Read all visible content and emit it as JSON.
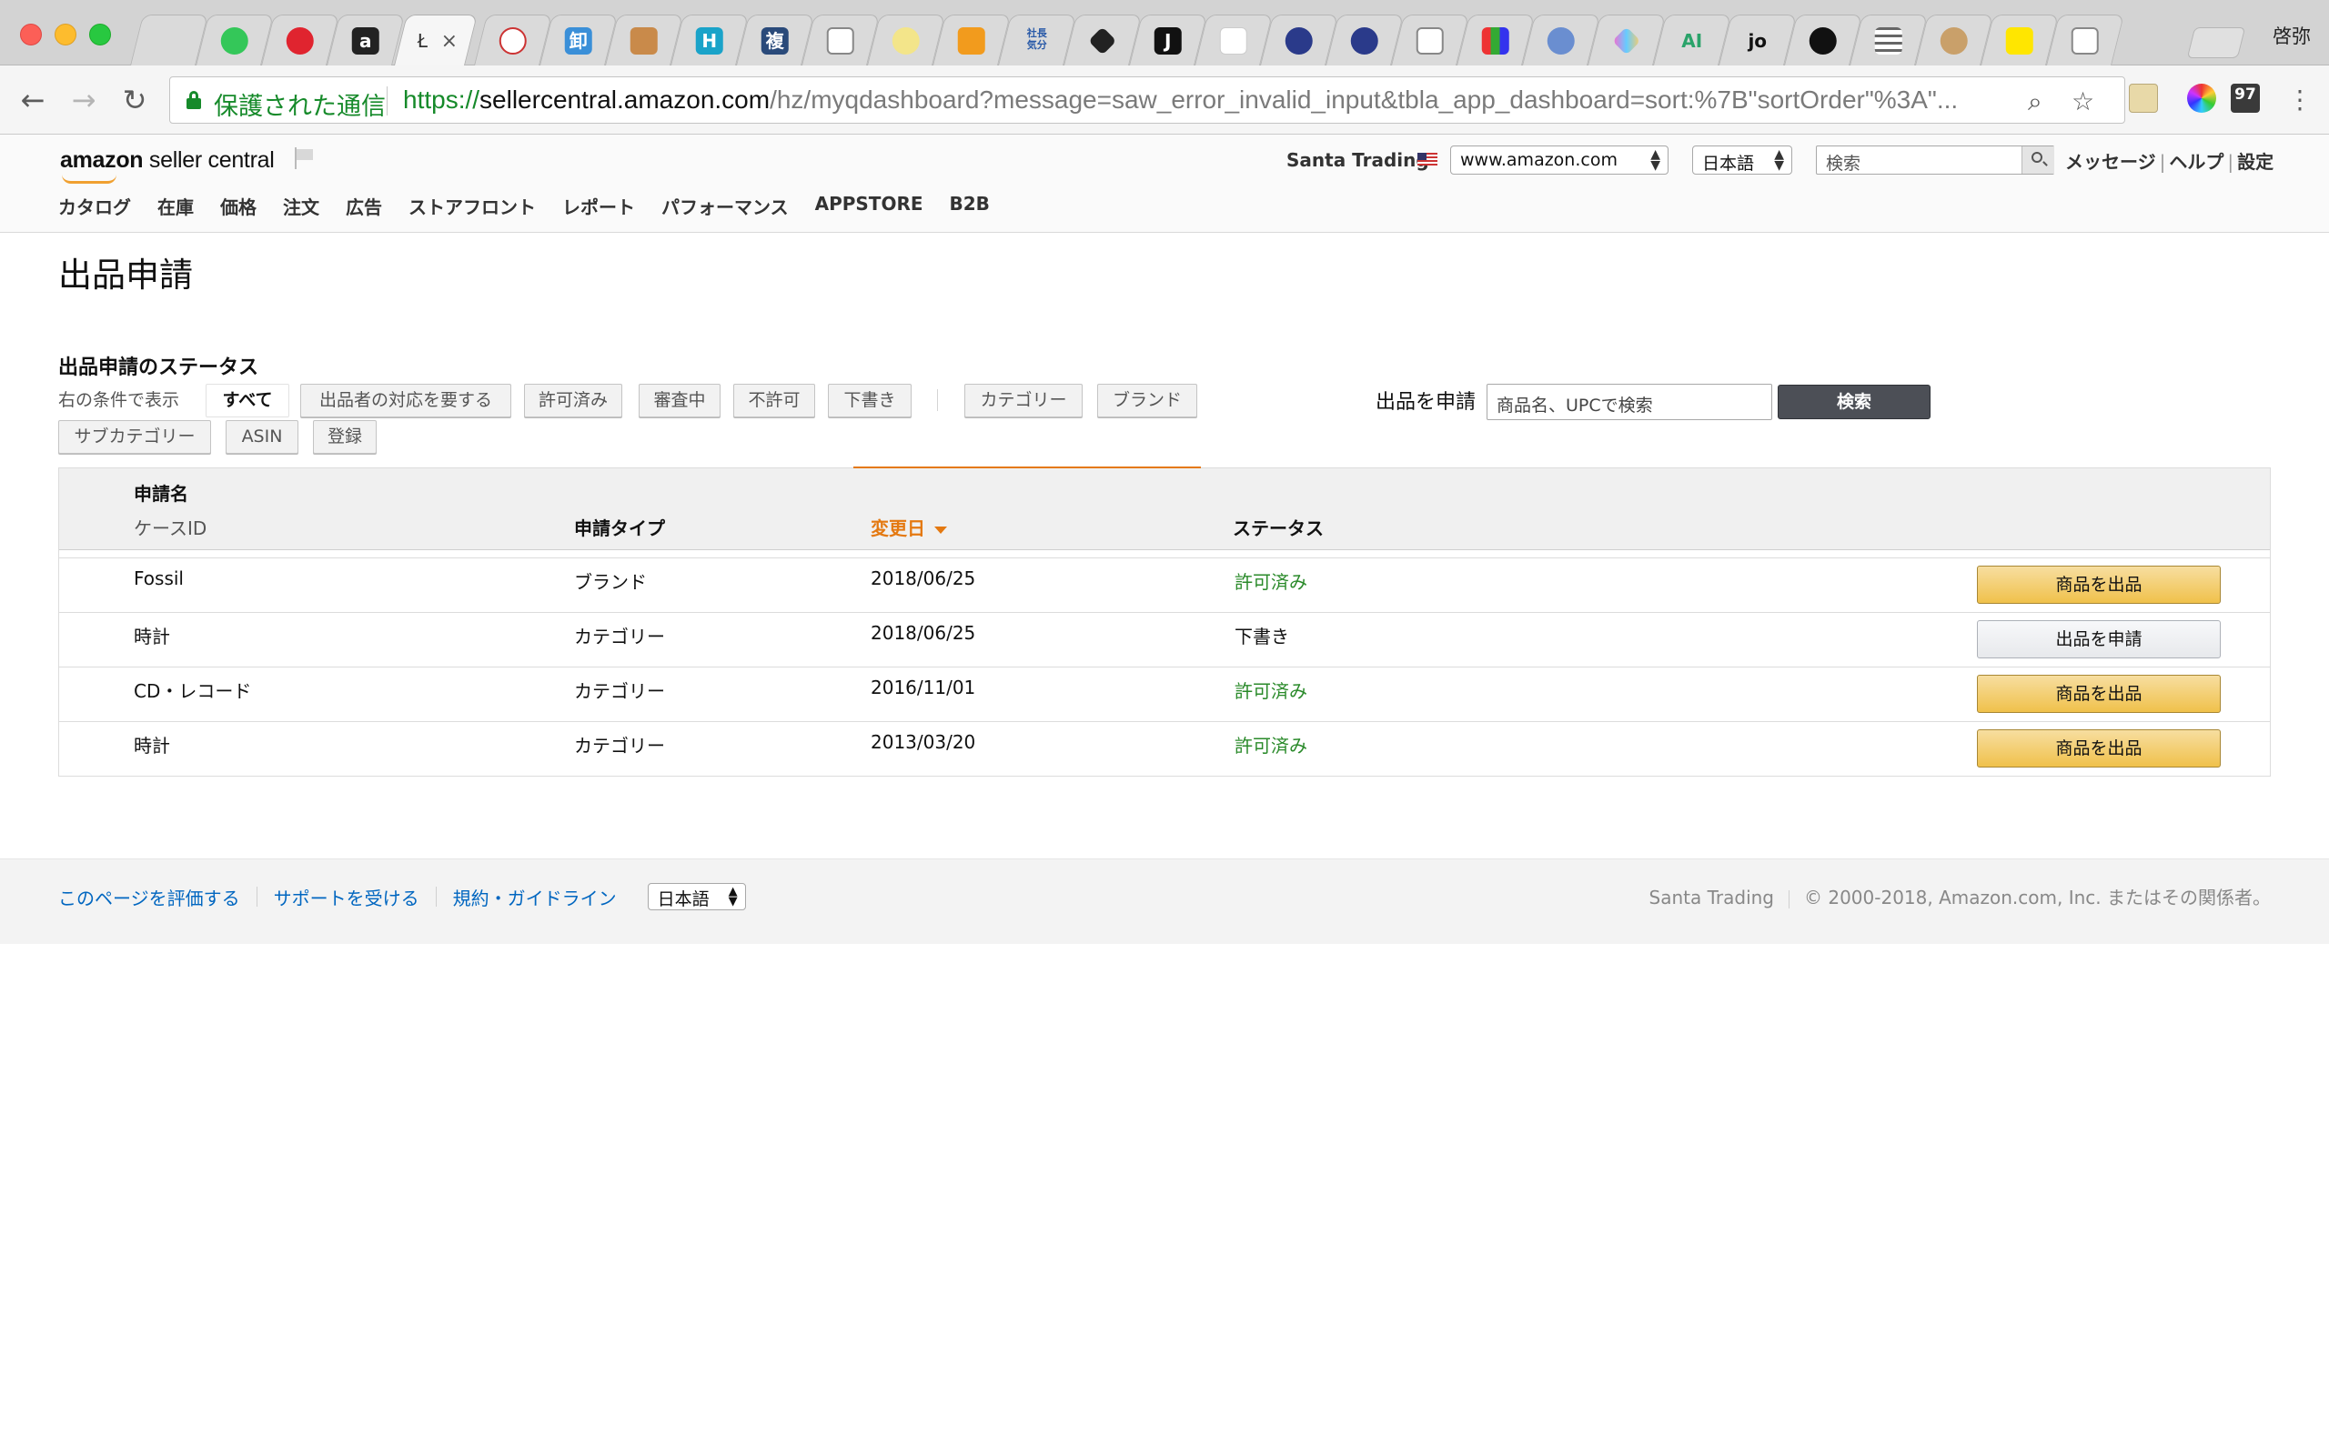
{
  "browser": {
    "profile_name": "啓弥",
    "active_tab_title": "Ł",
    "tab_favicons": [
      "apple-icon",
      "green-chat-icon",
      "red-d-icon",
      "amazon-a-icon",
      "active-tab",
      "crest-icon",
      "wholesale-icon",
      "package-icon",
      "h-icon",
      "kanji-icon",
      "doc-icon",
      "badge-icon",
      "analytics-icon",
      "shacho-icon",
      "diamond-icon",
      "j-icon",
      "blank-icon",
      "globe-icon",
      "globe-icon",
      "doc-icon",
      "color-grid-icon",
      "bird-icon",
      "diamond-color-icon",
      "ai-icon",
      "jo-icon",
      "bird-black-icon",
      "lines-icon",
      "mailchimp-icon",
      "yellow-icon",
      "doc-icon"
    ],
    "tab_texts": {
      "shacho": "社長気分",
      "ai": "AI",
      "jo": "jo",
      "wholesale": "卸",
      "kanji": "複",
      "amazon": "a"
    },
    "omnibox": {
      "secure_label": "保護された通信",
      "url_scheme": "https://",
      "url_host": "sellercentral.amazon.com",
      "url_path": "/hz/myqdashboard?message=saw_error_invalid_input&tbla_app_dashboard=sort:%7B\"sortOrder\"%3A\"..."
    },
    "extension_badge": "97"
  },
  "header": {
    "logo_bold": "amazon",
    "logo_rest": " seller central",
    "account_name": "Santa Trading",
    "marketplace": "www.amazon.com",
    "language": "日本語",
    "search_placeholder": "検索",
    "links": [
      "メッセージ",
      "ヘルプ",
      "設定"
    ],
    "nav": [
      "カタログ",
      "在庫",
      "価格",
      "注文",
      "広告",
      "ストアフロント",
      "レポート",
      "パフォーマンス",
      "APPSTORE",
      "B2B"
    ]
  },
  "page": {
    "title": "出品申請",
    "section_title": "出品申請のステータス",
    "filter_label": "右の条件で表示",
    "status_filters": [
      "すべて",
      "出品者の対応を要する",
      "許可済み",
      "審査中",
      "不許可",
      "下書き"
    ],
    "type_filters": [
      "カテゴリー",
      "ブランド",
      "サブカテゴリー",
      "ASIN",
      "登録"
    ],
    "apply_label": "出品を申請",
    "apply_placeholder": "商品名、UPCで検索",
    "apply_button": "検索"
  },
  "table": {
    "headers": {
      "name": "申請名",
      "case_id": "ケースID",
      "type": "申請タイプ",
      "date": "変更日",
      "status": "ステータス"
    },
    "rows": [
      {
        "name": "Fossil",
        "type": "ブランド",
        "date": "2018/06/25",
        "status": "許可済み",
        "action": "商品を出品"
      },
      {
        "name": "時計",
        "type": "カテゴリー",
        "date": "2018/06/25",
        "status": "下書き",
        "action": "出品を申請"
      },
      {
        "name": "CD・レコード",
        "type": "カテゴリー",
        "date": "2016/11/01",
        "status": "許可済み",
        "action": "商品を出品"
      },
      {
        "name": "時計",
        "type": "カテゴリー",
        "date": "2013/03/20",
        "status": "許可済み",
        "action": "商品を出品"
      }
    ]
  },
  "footer": {
    "links": [
      "このページを評価する",
      "サポートを受ける",
      "規約・ガイドライン"
    ],
    "language": "日本語",
    "account": "Santa Trading",
    "copyright": "© 2000-2018, Amazon.com, Inc. またはその関係者。"
  },
  "colors": {
    "accent_orange": "#e47911",
    "status_green": "#2a8a2a",
    "link_blue": "#0066c0",
    "secure_green": "#168a2a",
    "primary_button": "#f0c14b"
  }
}
